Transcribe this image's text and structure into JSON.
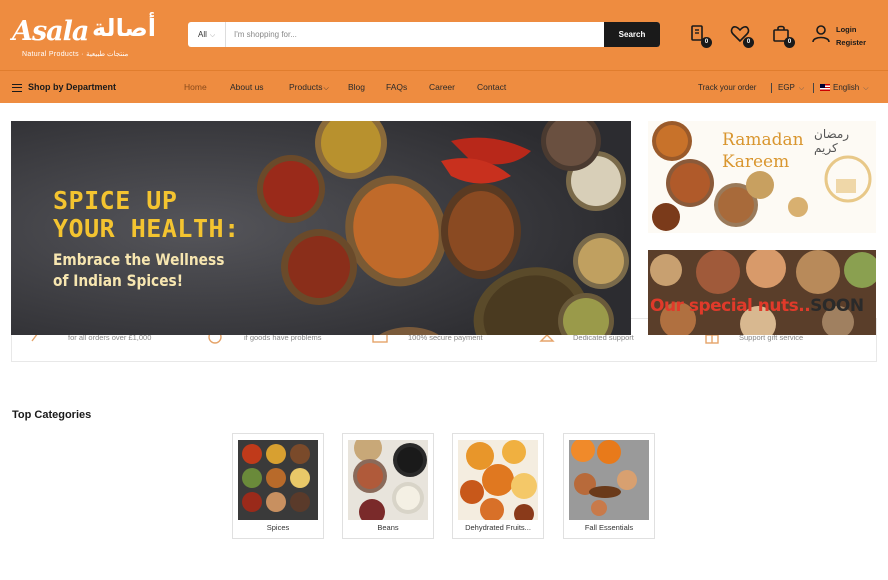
{
  "brand": {
    "name_en": "Asala",
    "name_ar": "أصالة",
    "tagline": "Natural Products · منتجات طبيعية"
  },
  "search": {
    "category": "All",
    "placeholder": "I'm shopping for...",
    "button_label": "Search"
  },
  "header_icons": {
    "compare_count": "0",
    "wishlist_count": "0",
    "cart_count": "0",
    "login_label": "Login",
    "register_label": "Register"
  },
  "nav": {
    "department_label": "Shop by Department",
    "items": [
      "Home",
      "About us",
      "Products",
      "Blog",
      "FAQs",
      "Career",
      "Contact"
    ],
    "track_order": "Track your order",
    "currency": "EGP",
    "language": "English"
  },
  "hero": {
    "title_line1": "Spice up",
    "title_line2": "your health:",
    "subtitle_line1": "Embrace the Wellness",
    "subtitle_line2": "of Indian Spices!"
  },
  "promos": {
    "ramadan_title_1": "Ramadan",
    "ramadan_title_2": "Kareem",
    "ramadan_ar": "رمضان كريم",
    "nuts_text_1": "Our special nuts..",
    "nuts_text_2": "SOON"
  },
  "features": [
    "for all orders over £1,000",
    "if goods have problems",
    "100% secure payment",
    "Dedicated support",
    "Support gift service"
  ],
  "categories": {
    "heading": "Top Categories",
    "items": [
      {
        "label": "Spices"
      },
      {
        "label": "Beans"
      },
      {
        "label": "Dehydrated Fruits..."
      },
      {
        "label": "Fall Essentials"
      }
    ]
  },
  "colors": {
    "brand_orange": "#ee8c40",
    "dark": "#1a1a1a",
    "hero_title": "#f4c430"
  }
}
